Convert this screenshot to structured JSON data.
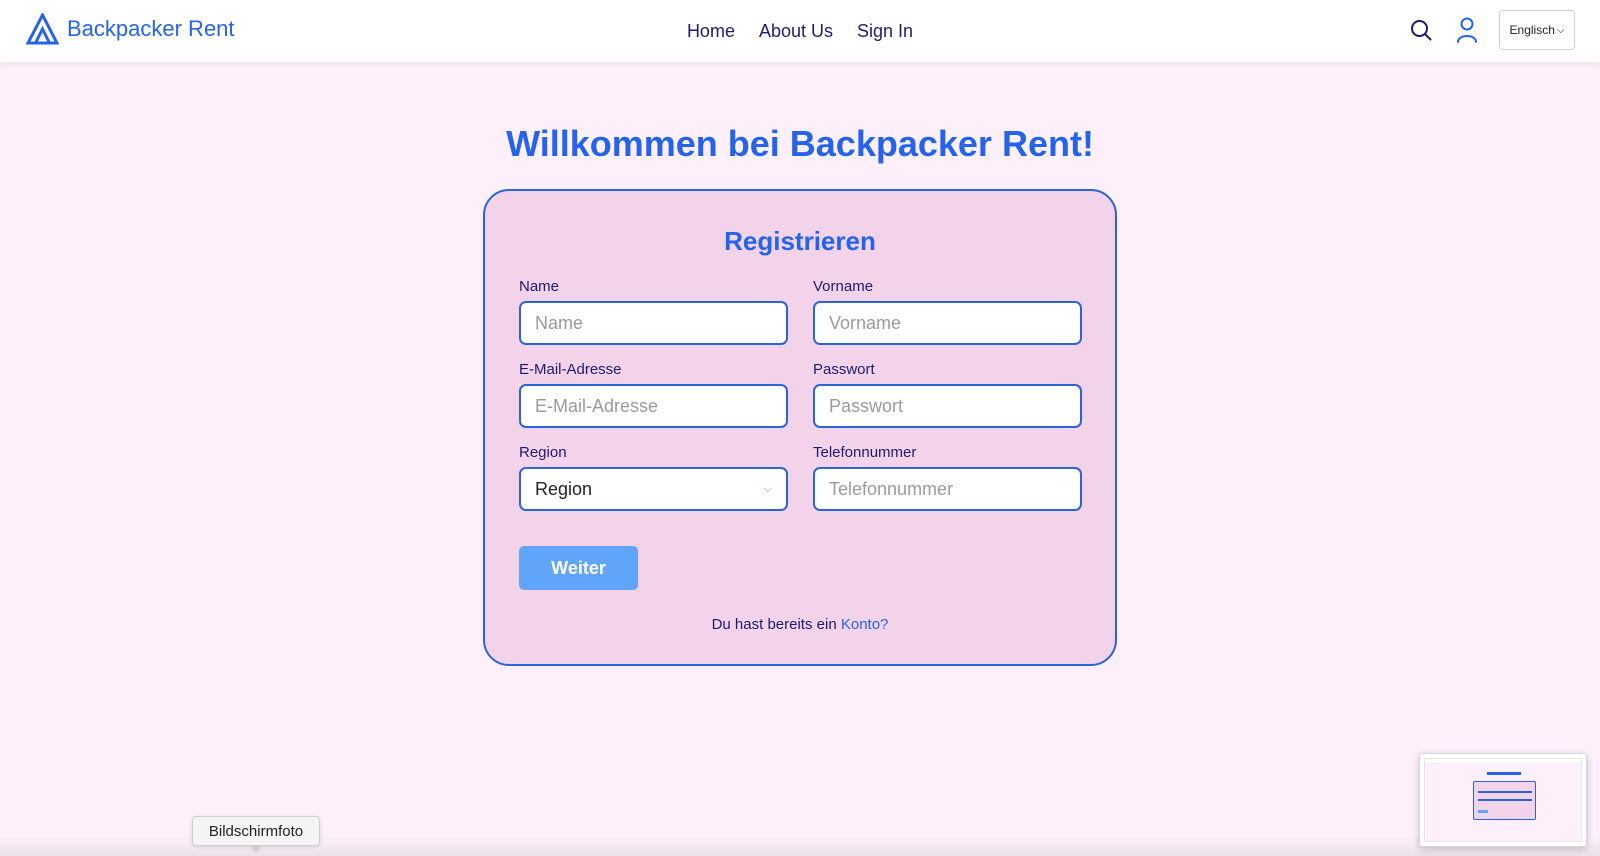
{
  "header": {
    "brand": "Backpacker Rent",
    "nav": [
      {
        "label": "Home"
      },
      {
        "label": "About Us"
      },
      {
        "label": "Sign In"
      }
    ],
    "language": "Englisch",
    "icons": [
      "search-icon",
      "user-icon",
      "chevron-down-icon"
    ]
  },
  "main": {
    "title": "Willkommen bei Backpacker Rent!",
    "form": {
      "title": "Registrieren",
      "fields": {
        "name": {
          "label": "Name",
          "placeholder": "Name",
          "value": ""
        },
        "vorname": {
          "label": "Vorname",
          "placeholder": "Vorname",
          "value": ""
        },
        "email": {
          "label": "E-Mail-Adresse",
          "placeholder": "E-Mail-Adresse",
          "value": ""
        },
        "passwort": {
          "label": "Passwort",
          "placeholder": "Passwort",
          "value": ""
        },
        "region": {
          "label": "Region",
          "selected": "Region"
        },
        "telefon": {
          "label": "Telefonnummer",
          "placeholder": "Telefonnummer",
          "value": ""
        }
      },
      "submit_label": "Weiter",
      "login_prompt": "Du hast bereits ein",
      "login_link": "Konto?"
    }
  },
  "overlay": {
    "tooltip": "Bildschirmfoto"
  },
  "colors": {
    "accent": "#2563eb",
    "button": "#60a5fa",
    "background": "#fdf0fb",
    "card": "#f2d3ea",
    "text_dark": "#1e1b6e"
  }
}
